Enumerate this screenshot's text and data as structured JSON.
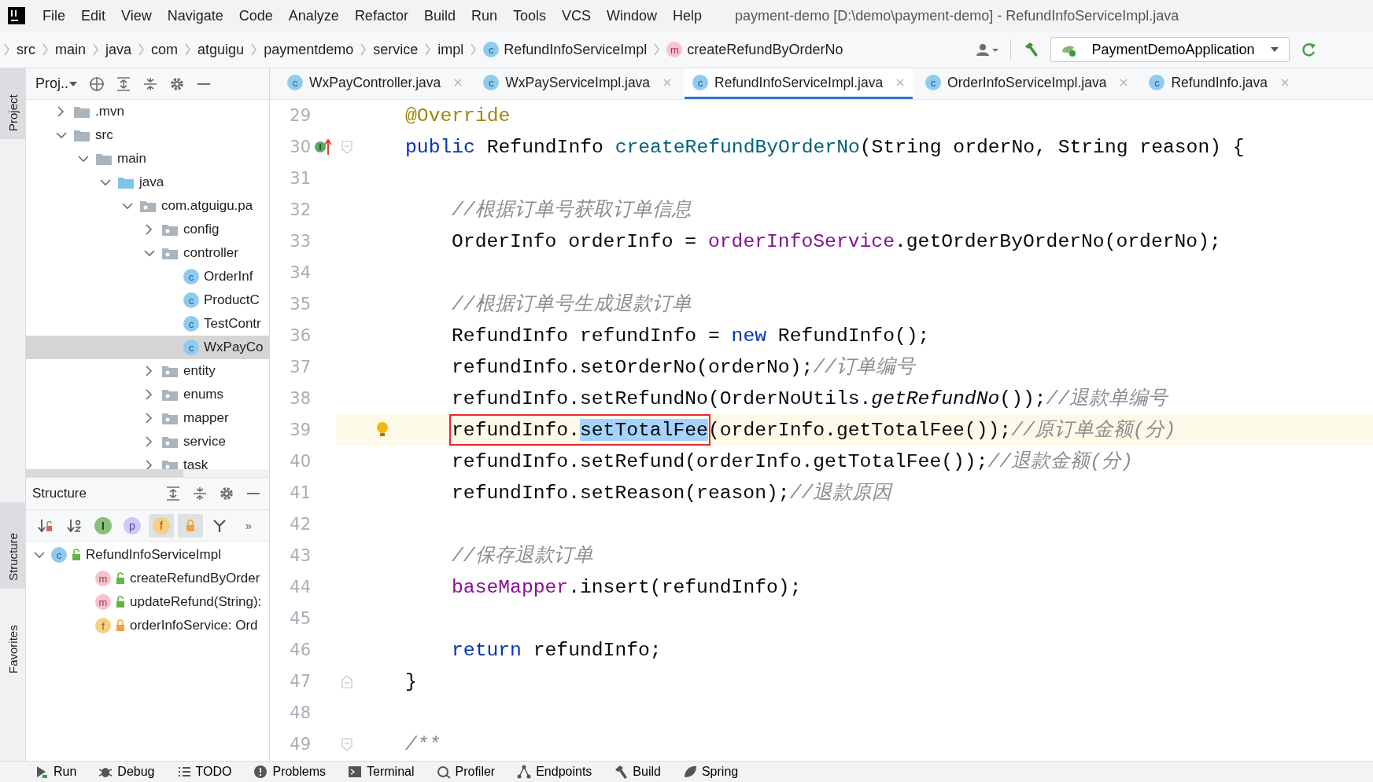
{
  "menu_bar": {
    "items": [
      "File",
      "Edit",
      "View",
      "Navigate",
      "Code",
      "Analyze",
      "Refactor",
      "Build",
      "Run",
      "Tools",
      "VCS",
      "Window",
      "Help"
    ],
    "title": "payment-demo [D:\\demo\\payment-demo] - RefundInfoServiceImpl.java"
  },
  "breadcrumbs": [
    {
      "label": "src",
      "kind": "dir"
    },
    {
      "label": "main",
      "kind": "dir"
    },
    {
      "label": "java",
      "kind": "dir"
    },
    {
      "label": "com",
      "kind": "dir"
    },
    {
      "label": "atguigu",
      "kind": "dir"
    },
    {
      "label": "paymentdemo",
      "kind": "dir"
    },
    {
      "label": "service",
      "kind": "dir"
    },
    {
      "label": "impl",
      "kind": "dir"
    },
    {
      "label": "RefundInfoServiceImpl",
      "kind": "class",
      "icon_letter": "c"
    },
    {
      "label": "createRefundByOrderNo",
      "kind": "method",
      "icon_letter": "m"
    }
  ],
  "run_config": "PaymentDemoApplication",
  "side_tabs": [
    {
      "label": "Project",
      "selected": true
    },
    {
      "label": "Structure",
      "selected": true
    },
    {
      "label": "Favorites",
      "selected": false
    }
  ],
  "project_panel": {
    "title": "Proj..",
    "tree": [
      {
        "label": ".mvn",
        "kind": "folder",
        "expanded": false,
        "selected": false
      },
      {
        "label": "src",
        "kind": "folder",
        "expanded": true,
        "selected": false,
        "children": [
          {
            "label": "main",
            "kind": "folder",
            "expanded": true,
            "selected": false,
            "children": [
              {
                "label": "java",
                "kind": "source",
                "expanded": true,
                "selected": false,
                "children": [
                  {
                    "label": "com.atguigu.pa",
                    "kind": "package",
                    "expanded": true,
                    "selected": false,
                    "children": [
                      {
                        "label": "config",
                        "kind": "package",
                        "expanded": false,
                        "selected": false
                      },
                      {
                        "label": "controller",
                        "kind": "package",
                        "expanded": true,
                        "selected": false,
                        "children": [
                          {
                            "label": "OrderInf",
                            "kind": "class",
                            "icon_letter": "c",
                            "selected": false
                          },
                          {
                            "label": "ProductC",
                            "kind": "class",
                            "icon_letter": "c",
                            "selected": false
                          },
                          {
                            "label": "TestContr",
                            "kind": "class",
                            "icon_letter": "c",
                            "selected": false
                          },
                          {
                            "label": "WxPayCo",
                            "kind": "class",
                            "icon_letter": "c",
                            "selected": true
                          }
                        ]
                      },
                      {
                        "label": "entity",
                        "kind": "package",
                        "expanded": false,
                        "selected": false
                      },
                      {
                        "label": "enums",
                        "kind": "package",
                        "expanded": false,
                        "selected": false
                      },
                      {
                        "label": "mapper",
                        "kind": "package",
                        "expanded": false,
                        "selected": false
                      },
                      {
                        "label": "service",
                        "kind": "package",
                        "expanded": false,
                        "selected": false
                      },
                      {
                        "label": "task",
                        "kind": "package",
                        "expanded": false,
                        "selected": false
                      }
                    ]
                  }
                ]
              }
            ]
          }
        ]
      }
    ]
  },
  "structure_panel": {
    "title": "Structure",
    "toolbar": [
      {
        "kind": "sort-visibility",
        "on": false
      },
      {
        "kind": "sort-alpha",
        "on": false
      },
      {
        "kind": "inherited",
        "glyph": "I",
        "on": false
      },
      {
        "kind": "properties",
        "glyph": "p",
        "on": false
      },
      {
        "kind": "fields",
        "glyph": "f",
        "on": true
      },
      {
        "kind": "non-public",
        "on": true
      },
      {
        "kind": "filter",
        "on": false
      },
      {
        "kind": "more",
        "glyph": "»",
        "on": false
      }
    ],
    "tree": [
      {
        "label": "RefundInfoServiceImpl",
        "kind": "class",
        "icon_letter": "c",
        "locked": false,
        "expanded": true,
        "children": [
          {
            "label": "createRefundByOrder",
            "kind": "method",
            "icon_letter": "m",
            "locked": false
          },
          {
            "label": "updateRefund(String):",
            "kind": "method",
            "icon_letter": "m",
            "locked": false
          },
          {
            "label": "orderInfoService: Ord",
            "kind": "field",
            "icon_letter": "f",
            "locked": true
          }
        ]
      }
    ]
  },
  "editor_tabs": [
    {
      "label": "WxPayController.java",
      "icon_letter": "c",
      "selected": false
    },
    {
      "label": "WxPayServiceImpl.java",
      "icon_letter": "c",
      "selected": false
    },
    {
      "label": "RefundInfoServiceImpl.java",
      "icon_letter": "c",
      "selected": true
    },
    {
      "label": "OrderInfoServiceImpl.java",
      "icon_letter": "c",
      "selected": false
    },
    {
      "label": "RefundInfo.java",
      "icon_letter": "c",
      "selected": false
    }
  ],
  "code_lines": [
    {
      "number": "29",
      "current": false,
      "kind": "member",
      "segments": [
        {
          "text": "@Override",
          "kind": "annotation"
        }
      ]
    },
    {
      "number": "30",
      "current": false,
      "implements_marker": true,
      "fold_start": true,
      "kind": "member",
      "segments": [
        {
          "text": "public",
          "kind": "keyword"
        },
        {
          "text": " RefundInfo ",
          "kind": "plain"
        },
        {
          "text": "createRefundByOrderNo",
          "kind": "declaration"
        },
        {
          "text": "(String orderNo, String reason) {",
          "kind": "plain"
        }
      ]
    },
    {
      "number": "31",
      "current": false,
      "kind": "blank"
    },
    {
      "number": "32",
      "current": false,
      "kind": "body",
      "segments": [
        {
          "text": "//根据订单号获取订单信息",
          "kind": "comment"
        }
      ]
    },
    {
      "number": "33",
      "current": false,
      "kind": "body",
      "segments": [
        {
          "text": "OrderInfo orderInfo = ",
          "kind": "plain"
        },
        {
          "text": "orderInfoService",
          "kind": "field"
        },
        {
          "text": ".getOrderByOrderNo(orderNo);",
          "kind": "plain"
        }
      ]
    },
    {
      "number": "34",
      "current": false,
      "kind": "blank"
    },
    {
      "number": "35",
      "current": false,
      "kind": "body",
      "segments": [
        {
          "text": "//根据订单号生成退款订单",
          "kind": "comment"
        }
      ]
    },
    {
      "number": "36",
      "current": false,
      "kind": "body",
      "segments": [
        {
          "text": "RefundInfo refundInfo = ",
          "kind": "plain"
        },
        {
          "text": "new",
          "kind": "keyword"
        },
        {
          "text": " RefundInfo();",
          "kind": "plain"
        }
      ]
    },
    {
      "number": "37",
      "current": false,
      "kind": "body",
      "segments": [
        {
          "text": "refundInfo.setOrderNo(orderNo);",
          "kind": "plain"
        },
        {
          "text": "//订单编号",
          "kind": "comment"
        }
      ]
    },
    {
      "number": "38",
      "current": false,
      "kind": "body",
      "segments": [
        {
          "text": "refundInfo.setRefundNo(OrderNoUtils.",
          "kind": "plain"
        },
        {
          "text": "getRefundNo",
          "kind": "static"
        },
        {
          "text": "());",
          "kind": "plain"
        },
        {
          "text": "//退款单编号",
          "kind": "comment"
        }
      ]
    },
    {
      "number": "39",
      "current": true,
      "bulb": true,
      "kind": "body",
      "segments": [
        {
          "text": "refundInfo.",
          "kind": "plain",
          "boxed": true,
          "selected": false
        },
        {
          "text": "setTotalFee",
          "kind": "plain",
          "boxed": true,
          "selected": true
        },
        {
          "text": "(orderInfo.getTotalFee());",
          "kind": "plain",
          "boxed": false,
          "selected": false
        },
        {
          "text": "//原订单金额(分)",
          "kind": "comment",
          "boxed": false,
          "selected": false
        }
      ]
    },
    {
      "number": "40",
      "current": false,
      "kind": "body",
      "segments": [
        {
          "text": "refundInfo.setRefund(orderInfo.getTotalFee());",
          "kind": "plain"
        },
        {
          "text": "//退款金额(分)",
          "kind": "comment"
        }
      ]
    },
    {
      "number": "41",
      "current": false,
      "kind": "body",
      "segments": [
        {
          "text": "refundInfo.setReason(reason);",
          "kind": "plain"
        },
        {
          "text": "//退款原因",
          "kind": "comment"
        }
      ]
    },
    {
      "number": "42",
      "current": false,
      "kind": "blank"
    },
    {
      "number": "43",
      "current": false,
      "kind": "body",
      "segments": [
        {
          "text": "//保存退款订单",
          "kind": "comment"
        }
      ]
    },
    {
      "number": "44",
      "current": false,
      "kind": "body",
      "segments": [
        {
          "text": "baseMapper",
          "kind": "field"
        },
        {
          "text": ".insert(refundInfo);",
          "kind": "plain"
        }
      ]
    },
    {
      "number": "45",
      "current": false,
      "kind": "blank"
    },
    {
      "number": "46",
      "current": false,
      "kind": "body",
      "segments": [
        {
          "text": "return",
          "kind": "keyword"
        },
        {
          "text": " refundInfo;",
          "kind": "plain"
        }
      ]
    },
    {
      "number": "47",
      "current": false,
      "fold_end": true,
      "kind": "member",
      "segments": [
        {
          "text": "}",
          "kind": "plain"
        }
      ]
    },
    {
      "number": "48",
      "current": false,
      "kind": "blank"
    },
    {
      "number": "49",
      "current": false,
      "fold_start": true,
      "kind": "member",
      "segments": [
        {
          "text": "/**",
          "kind": "comment"
        }
      ]
    }
  ],
  "tool_windows": [
    {
      "label": "Run",
      "kind": "run"
    },
    {
      "label": "Debug",
      "kind": "debug"
    },
    {
      "label": "TODO",
      "kind": "todo"
    },
    {
      "label": "Problems",
      "kind": "problems"
    },
    {
      "label": "Terminal",
      "kind": "terminal"
    },
    {
      "label": "Profiler",
      "kind": "profiler"
    },
    {
      "label": "Endpoints",
      "kind": "endpoints"
    },
    {
      "label": "Build",
      "kind": "build"
    },
    {
      "label": "Spring",
      "kind": "spring"
    }
  ]
}
